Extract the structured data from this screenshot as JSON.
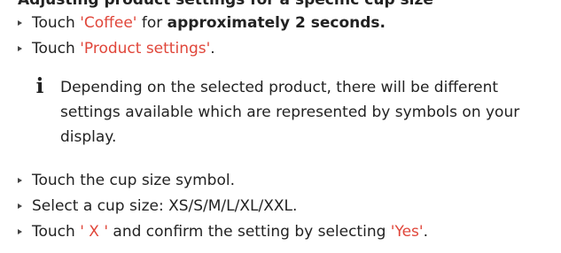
{
  "document": {
    "clipped_heading": "Adjusting product settings for a specific cup size",
    "steps_top": [
      {
        "parts": [
          {
            "text": "Touch ",
            "style": "normal"
          },
          {
            "text": "'Coffee'",
            "style": "accent"
          },
          {
            "text": " for ",
            "style": "normal"
          },
          {
            "text": "approximately 2 seconds.",
            "style": "bold"
          }
        ]
      },
      {
        "parts": [
          {
            "text": "Touch ",
            "style": "normal"
          },
          {
            "text": "'Product settings'",
            "style": "accent"
          },
          {
            "text": ".",
            "style": "normal"
          }
        ]
      }
    ],
    "note": {
      "icon": "info-icon",
      "lines": [
        "Depending on the selected product, there will be different",
        "settings available which are represented by symbols on your",
        "display."
      ]
    },
    "steps_bottom": [
      {
        "parts": [
          {
            "text": "Touch the cup size symbol.",
            "style": "normal"
          }
        ]
      },
      {
        "parts": [
          {
            "text": "Select a cup size: XS/S/M/L/XL/XXL.",
            "style": "normal"
          }
        ]
      },
      {
        "parts": [
          {
            "text": "Touch ",
            "style": "normal"
          },
          {
            "text": "' X '",
            "style": "accent"
          },
          {
            "text": " and confirm the setting by selecting ",
            "style": "normal"
          },
          {
            "text": "'Yes'",
            "style": "accent"
          },
          {
            "text": ".",
            "style": "normal"
          }
        ]
      }
    ],
    "colors": {
      "accent": "#e0463a",
      "text": "#222222",
      "bullet": "#444444"
    }
  }
}
